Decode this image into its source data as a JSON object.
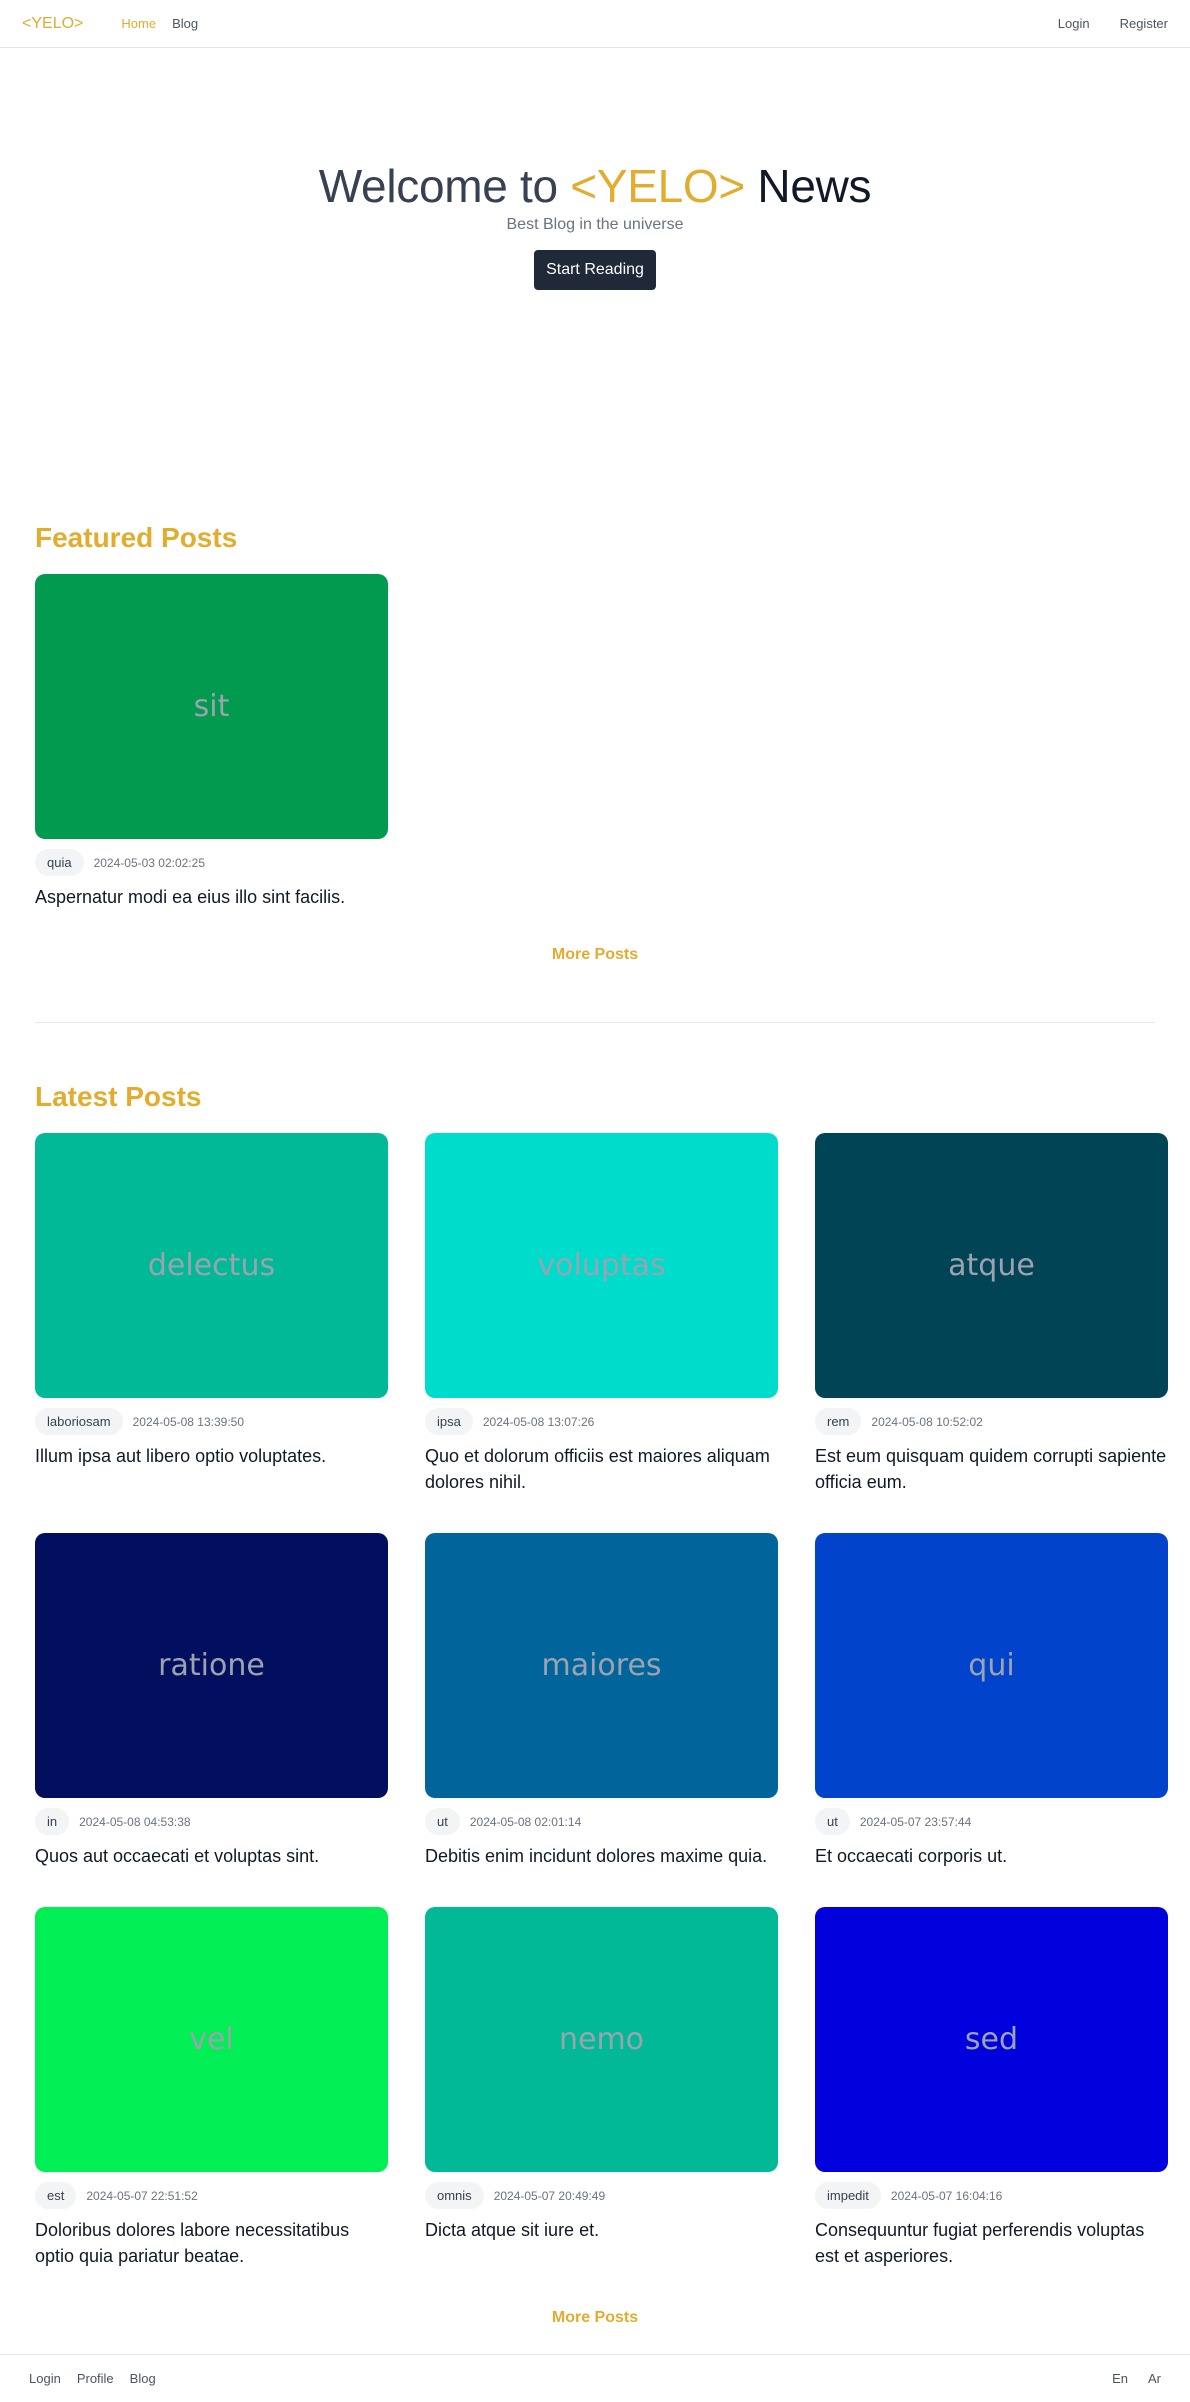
{
  "nav": {
    "brand": "<YELO>",
    "links": [
      {
        "label": "Home",
        "active": true
      },
      {
        "label": "Blog",
        "active": false
      }
    ],
    "right": [
      "Login",
      "Register"
    ]
  },
  "hero": {
    "welcome": "Welcome to",
    "brand": "<YELO>",
    "news": "News",
    "tagline": "Best Blog in the universe",
    "cta": "Start Reading"
  },
  "featured": {
    "title": "Featured Posts",
    "posts": [
      {
        "image_text": "sit",
        "color": "#019a4f",
        "tag": "quia",
        "date": "2024-05-03 02:02:25",
        "title": "Aspernatur modi ea eius illo sint facilis."
      }
    ],
    "more": "More Posts"
  },
  "latest": {
    "title": "Latest Posts",
    "posts": [
      {
        "image_text": "delectus",
        "color": "#01b997",
        "tag": "laboriosam",
        "date": "2024-05-08 13:39:50",
        "title": "Illum ipsa aut libero optio voluptates."
      },
      {
        "image_text": "voluptas",
        "color": "#00dccb",
        "tag": "ipsa",
        "date": "2024-05-08 13:07:26",
        "title": "Quo et dolorum officiis est maiores aliquam dolores nihil."
      },
      {
        "image_text": "atque",
        "color": "#014456",
        "tag": "rem",
        "date": "2024-05-08 10:52:02",
        "title": "Est eum quisquam quidem corrupti sapiente officia eum."
      },
      {
        "image_text": "ratione",
        "color": "#020f5f",
        "tag": "in",
        "date": "2024-05-08 04:53:38",
        "title": "Quos aut occaecati et voluptas sint."
      },
      {
        "image_text": "maiores",
        "color": "#01659b",
        "tag": "ut",
        "date": "2024-05-08 02:01:14",
        "title": "Debitis enim incidunt dolores maxime quia."
      },
      {
        "image_text": "qui",
        "color": "#0143cb",
        "tag": "ut",
        "date": "2024-05-07 23:57:44",
        "title": "Et occaecati corporis ut."
      },
      {
        "image_text": "vel",
        "color": "#01ee55",
        "tag": "est",
        "date": "2024-05-07 22:51:52",
        "title": "Doloribus dolores labore necessitatibus optio quia pariatur beatae."
      },
      {
        "image_text": "nemo",
        "color": "#01b996",
        "tag": "omnis",
        "date": "2024-05-07 20:49:49",
        "title": "Dicta atque sit iure et."
      },
      {
        "image_text": "sed",
        "color": "#0101dd",
        "tag": "impedit",
        "date": "2024-05-07 16:04:16",
        "title": "Consequuntur fugiat perferendis voluptas est et asperiores."
      }
    ],
    "more": "More Posts"
  },
  "footer": {
    "left": [
      "Login",
      "Profile",
      "Blog"
    ],
    "right": [
      "En",
      "Ar"
    ]
  }
}
